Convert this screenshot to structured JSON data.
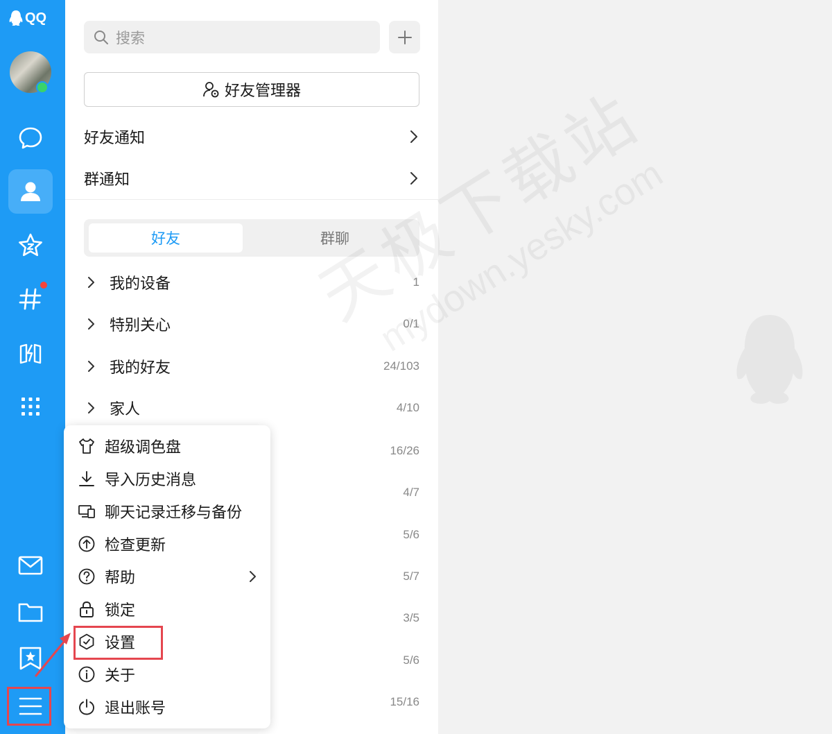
{
  "app": {
    "logo_text": "QQ"
  },
  "search": {
    "placeholder": "搜索"
  },
  "contacts": {
    "manager_label": "好友管理器",
    "notices": [
      {
        "label": "好友通知"
      },
      {
        "label": "群通知"
      }
    ],
    "tabs": [
      {
        "label": "好友",
        "active": true
      },
      {
        "label": "群聊",
        "active": false
      }
    ],
    "groups": [
      {
        "name": "我的设备",
        "count": "1"
      },
      {
        "name": "特别关心",
        "count": "0/1"
      },
      {
        "name": "我的好友",
        "count": "24/103"
      },
      {
        "name": "家人",
        "count": "4/10"
      }
    ],
    "hidden_counts": [
      "16/26",
      "4/7",
      "5/6",
      "5/7",
      "3/5",
      "5/6",
      "15/16"
    ]
  },
  "menu": {
    "items": [
      {
        "label": "超级调色盘",
        "icon": "shirt-icon"
      },
      {
        "label": "导入历史消息",
        "icon": "download-icon"
      },
      {
        "label": "聊天记录迁移与备份",
        "icon": "devices-icon"
      },
      {
        "label": "检查更新",
        "icon": "upload-circle-icon"
      },
      {
        "label": "帮助",
        "icon": "help-circle-icon",
        "has_submenu": true
      },
      {
        "label": "锁定",
        "icon": "lock-icon"
      },
      {
        "label": "设置",
        "icon": "settings-hex-icon",
        "highlighted": true
      },
      {
        "label": "关于",
        "icon": "info-icon"
      },
      {
        "label": "退出账号",
        "icon": "power-icon"
      }
    ]
  },
  "colors": {
    "accent": "#1e9bf5",
    "highlight": "#e5464f",
    "online": "#3ad26b",
    "notification": "#f5443b"
  }
}
